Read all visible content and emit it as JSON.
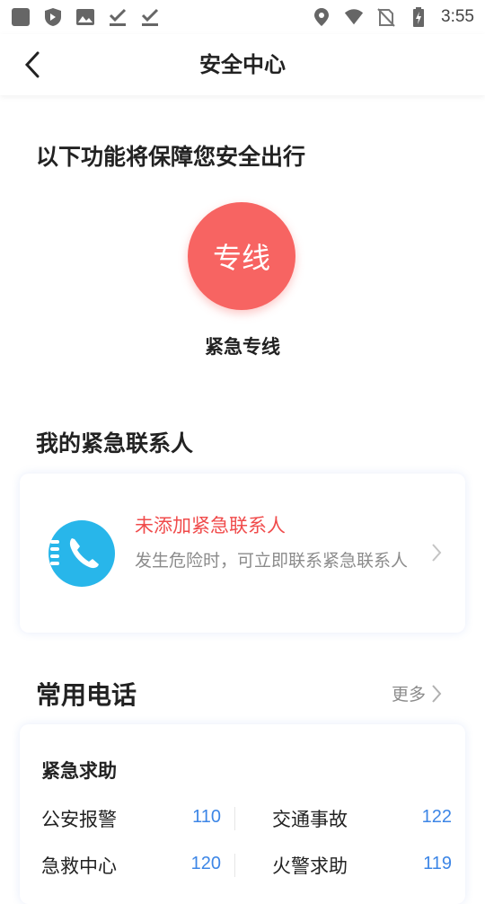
{
  "status_bar": {
    "time": "3:55",
    "left_icons": [
      "app-icon",
      "shield-icon",
      "image-icon",
      "download-done-icon",
      "download-done-icon"
    ],
    "right_icons": [
      "location-icon",
      "wifi-icon",
      "no-sim-icon",
      "battery-charging-icon"
    ]
  },
  "nav": {
    "title": "安全中心"
  },
  "features": {
    "title": "以下功能将保障您安全出行",
    "hotline_text": "专线",
    "hotline_label": "紧急专线",
    "hotline_color": "#f76462"
  },
  "emergency_contact": {
    "section_title": "我的紧急联系人",
    "title": "未添加紧急联系人",
    "description": "发生危险时，可立即联系紧急联系人",
    "icon_color": "#28b6ea"
  },
  "common_phones": {
    "section_title": "常用电话",
    "more_label": "更多",
    "group_title": "紧急求助",
    "rows": [
      [
        {
          "name": "公安报警",
          "number": "110"
        },
        {
          "name": "交通事故",
          "number": "122"
        }
      ],
      [
        {
          "name": "急救中心",
          "number": "120"
        },
        {
          "name": "火警求助",
          "number": "119"
        }
      ]
    ],
    "number_color": "#3d86e6"
  }
}
